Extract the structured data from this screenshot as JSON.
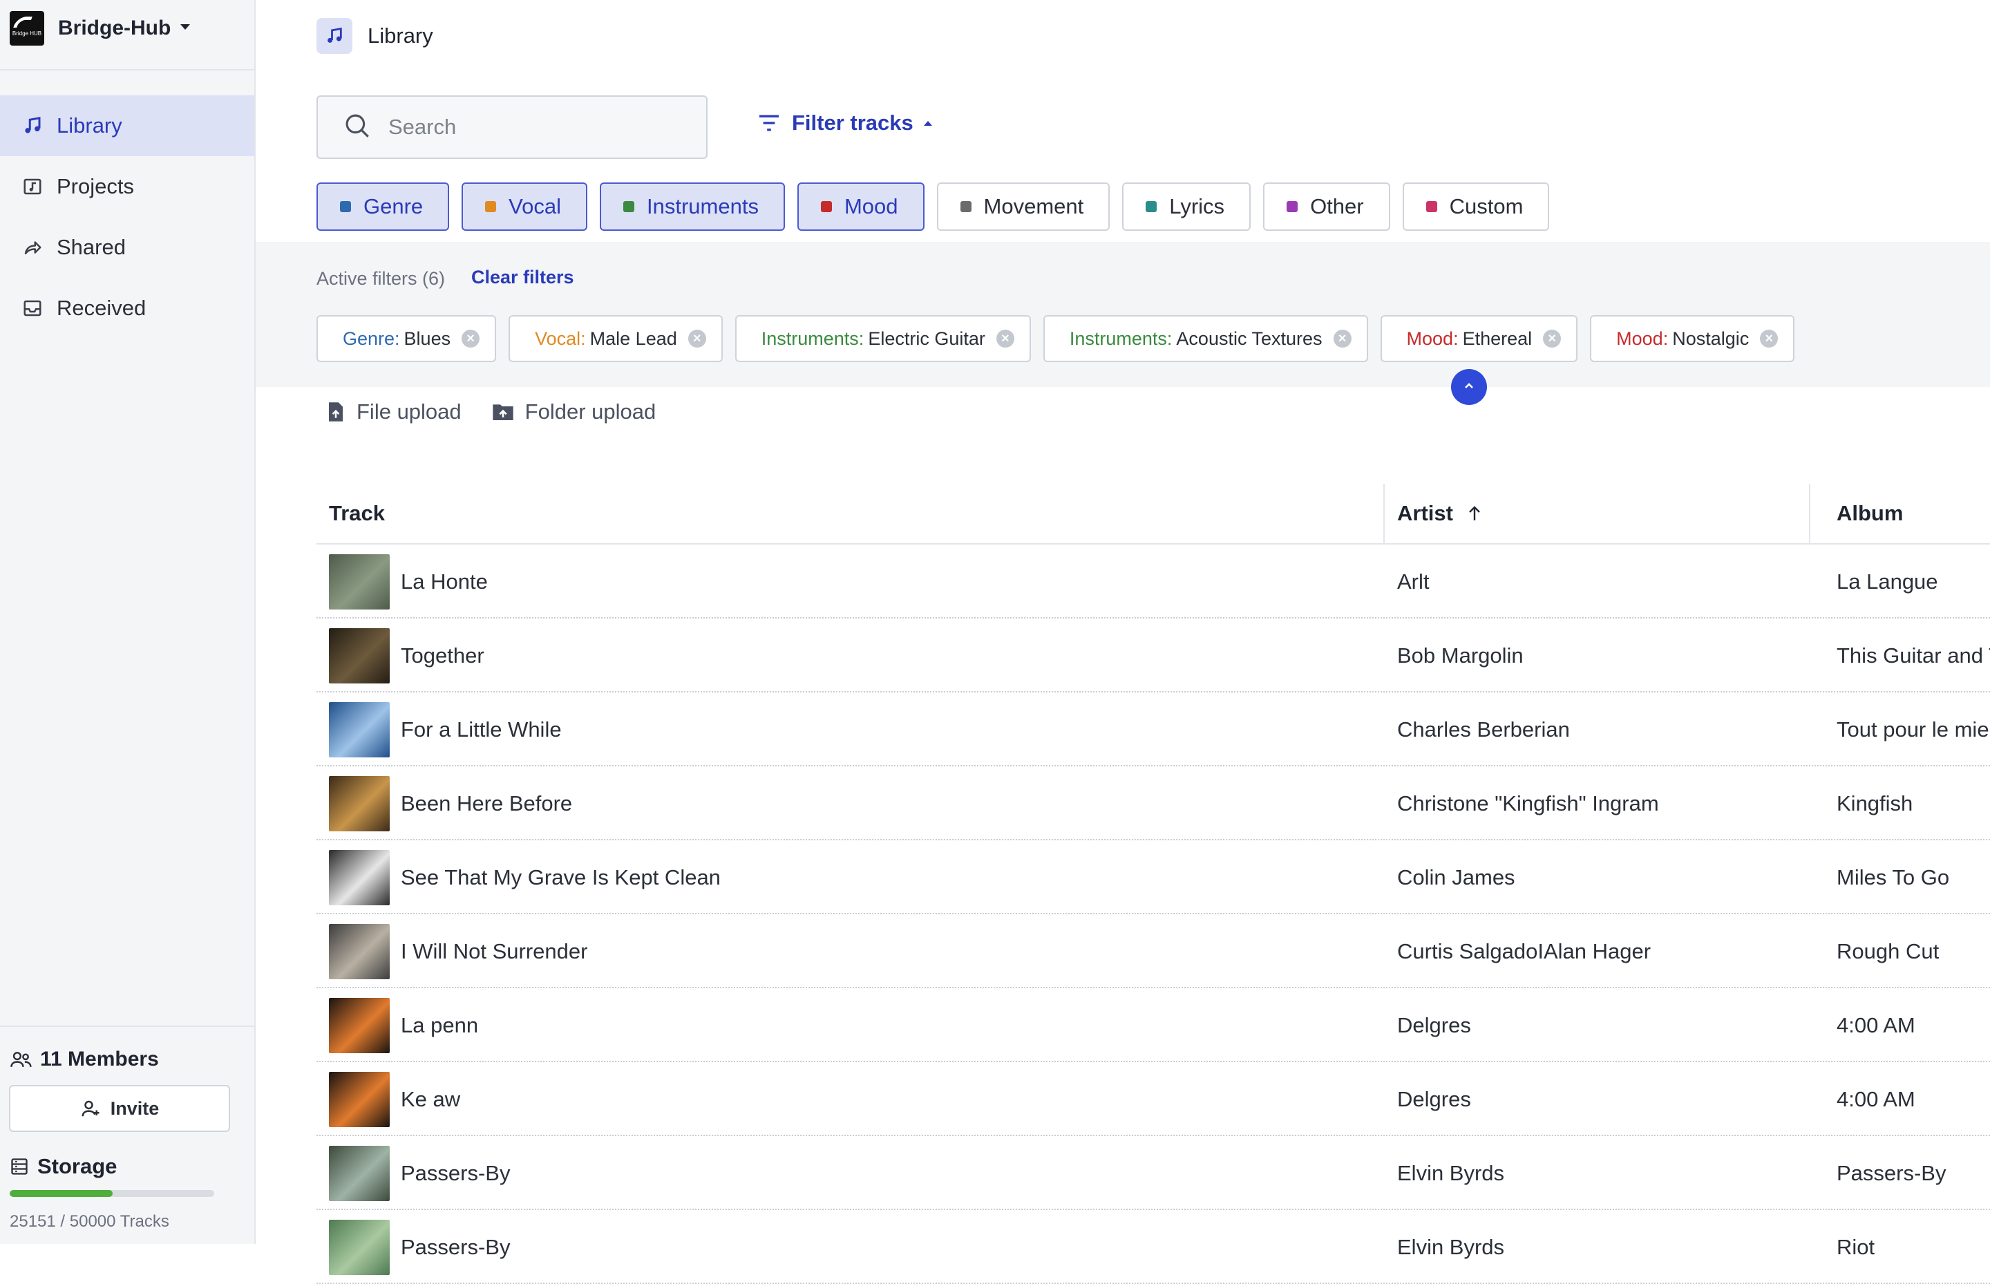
{
  "workspace": {
    "name": "Bridge-Hub",
    "logo_text": "Bridge HUB"
  },
  "sidebar": {
    "items": [
      {
        "label": "Library",
        "icon": "music-note-icon",
        "active": true
      },
      {
        "label": "Projects",
        "icon": "folder-music-icon",
        "active": false
      },
      {
        "label": "Shared",
        "icon": "share-icon",
        "active": false
      },
      {
        "label": "Received",
        "icon": "inbox-icon",
        "active": false
      }
    ],
    "members_label": "11 Members",
    "invite_label": "Invite",
    "storage_label": "Storage",
    "storage_text": "25151 / 50000 Tracks",
    "storage_used_fraction": 0.503
  },
  "header": {
    "title": "Library"
  },
  "search": {
    "placeholder": "Search"
  },
  "filter": {
    "toggle_label": "Filter tracks",
    "categories": [
      {
        "label": "Genre",
        "color": "#2e6ab0",
        "selected": true
      },
      {
        "label": "Vocal",
        "color": "#e08a22",
        "selected": true
      },
      {
        "label": "Instruments",
        "color": "#3a8a3f",
        "selected": true
      },
      {
        "label": "Mood",
        "color": "#c62b2b",
        "selected": true
      },
      {
        "label": "Movement",
        "color": "#6b6b6b",
        "selected": false
      },
      {
        "label": "Lyrics",
        "color": "#2a8c8c",
        "selected": false
      },
      {
        "label": "Other",
        "color": "#9b3ab5",
        "selected": false
      },
      {
        "label": "Custom",
        "color": "#cc3366",
        "selected": false
      }
    ],
    "active_label": "Active filters (6)",
    "clear_label": "Clear filters",
    "active": [
      {
        "key": "Genre:",
        "value": "Blues",
        "color": "#2e6ab0"
      },
      {
        "key": "Vocal:",
        "value": "Male Lead",
        "color": "#e08a22"
      },
      {
        "key": "Instruments:",
        "value": "Electric Guitar",
        "color": "#3a8a3f"
      },
      {
        "key": "Instruments:",
        "value": "Acoustic Textures",
        "color": "#3a8a3f"
      },
      {
        "key": "Mood:",
        "value": "Ethereal",
        "color": "#c62b2b"
      },
      {
        "key": "Mood:",
        "value": "Nostalgic",
        "color": "#c62b2b"
      }
    ]
  },
  "uploads": {
    "file_label": "File upload",
    "folder_label": "Folder upload"
  },
  "table": {
    "columns": {
      "track": "Track",
      "artist": "Artist",
      "album": "Album"
    },
    "sort": {
      "column": "artist",
      "direction": "ascending"
    },
    "rows": [
      {
        "track": "La Honte",
        "artist": "Arlt",
        "album": "La Langue",
        "thumb": [
          "#4f5b4a",
          "#8a9a82"
        ]
      },
      {
        "track": "Together",
        "artist": "Bob Margolin",
        "album": "This Guitar and To",
        "thumb": [
          "#231d14",
          "#6d5a3c"
        ]
      },
      {
        "track": "For a Little While",
        "artist": "Charles Berberian",
        "album": "Tout pour le mieu",
        "thumb": [
          "#1f4f8a",
          "#9ec3e8"
        ]
      },
      {
        "track": "Been Here Before",
        "artist": "Christone \"Kingfish\" Ingram",
        "album": "Kingfish",
        "thumb": [
          "#3b2a18",
          "#c8954a"
        ]
      },
      {
        "track": "See That My Grave Is Kept Clean",
        "artist": "Colin James",
        "album": "Miles To Go",
        "thumb": [
          "#2a2a2a",
          "#e6e6e6"
        ]
      },
      {
        "track": "I Will Not Surrender",
        "artist": "Curtis SalgadoIAlan Hager",
        "album": "Rough Cut",
        "thumb": [
          "#3d3d3d",
          "#b8b0a2"
        ]
      },
      {
        "track": "La penn",
        "artist": "Delgres",
        "album": "4:00 AM",
        "thumb": [
          "#1a1410",
          "#e07a2e"
        ]
      },
      {
        "track": "Ke aw",
        "artist": "Delgres",
        "album": "4:00 AM",
        "thumb": [
          "#1a1410",
          "#e07a2e"
        ]
      },
      {
        "track": "Passers-By",
        "artist": "Elvin Byrds",
        "album": "Passers-By",
        "thumb": [
          "#3c4a3a",
          "#9eb2a6"
        ]
      },
      {
        "track": "Passers-By",
        "artist": "Elvin Byrds",
        "album": "Riot",
        "thumb": [
          "#4e7a52",
          "#a9c9a0"
        ]
      }
    ]
  },
  "colors": {
    "accent": "#2a3bb8",
    "accent_bg": "#dde1f6",
    "storage": "#4fae3c",
    "collapse_button": "#2f4ad8"
  }
}
